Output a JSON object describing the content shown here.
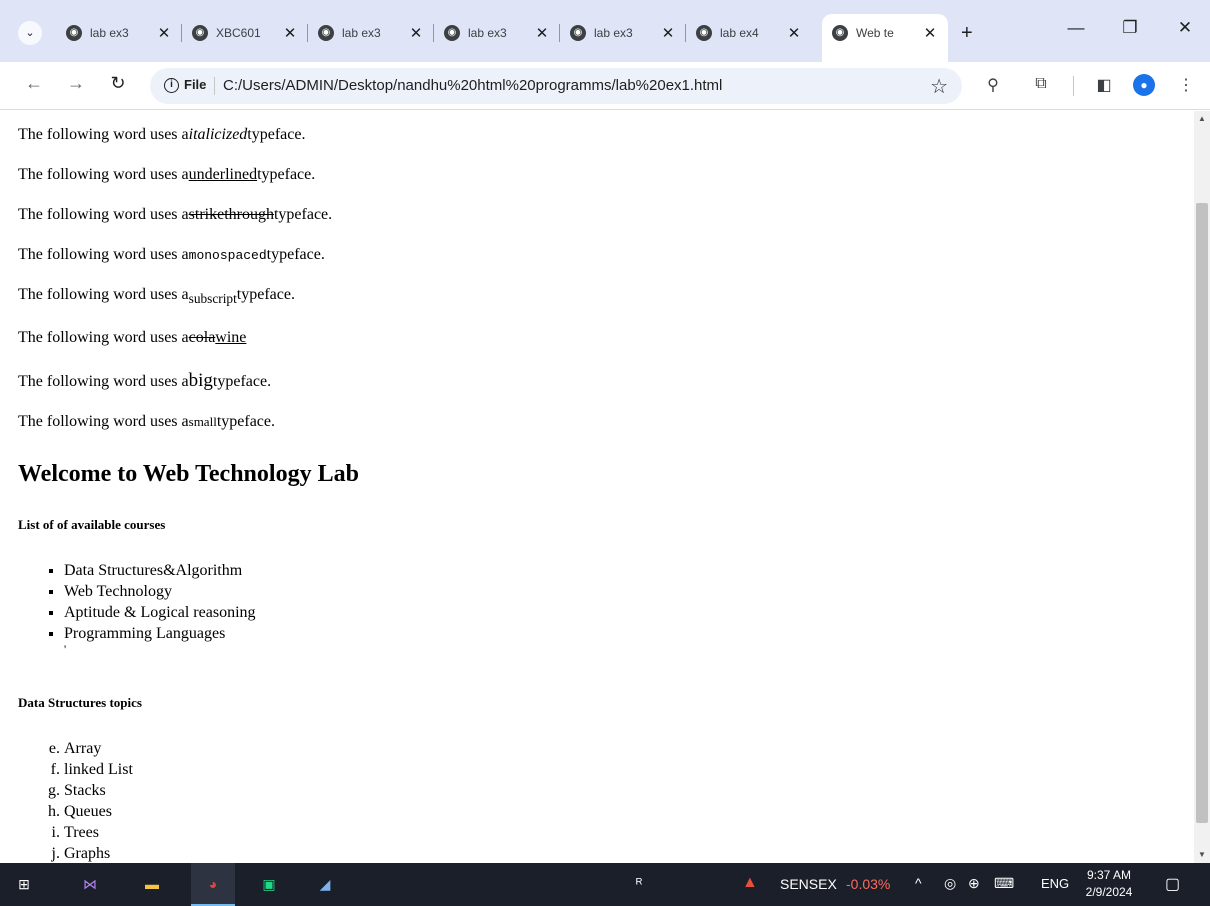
{
  "browser": {
    "tabs": [
      {
        "label": "lab ex3",
        "close": "✕"
      },
      {
        "label": "XBC601",
        "close": "✕"
      },
      {
        "label": "lab ex3",
        "close": "✕"
      },
      {
        "label": "lab ex3",
        "close": "✕"
      },
      {
        "label": "lab ex3",
        "close": "✕"
      },
      {
        "label": "lab ex4",
        "close": "✕"
      },
      {
        "label": "Web te",
        "close": "✕",
        "active": true
      }
    ],
    "new_tab": "+",
    "address_chip": "File",
    "url": "C:/Users/ADMIN/Desktop/nandhu%20html%20programms/lab%20ex1.html"
  },
  "page": {
    "prefix": "The following word uses a",
    "suffix": "typeface.",
    "lines": [
      {
        "word": "italicized"
      },
      {
        "word": "underlined"
      },
      {
        "word": "strikethrough"
      },
      {
        "word": "monospaced"
      },
      {
        "word": "subscript"
      },
      {
        "word_strike": "cola",
        "word_underline": "wine"
      },
      {
        "word": "big"
      },
      {
        "word": "small"
      }
    ],
    "heading": "Welcome to Web Technology Lab",
    "courses_title": "List of of available courses",
    "courses": [
      "Data Structures&Algorithm",
      "Web Technology",
      "Aptitude & Logical reasoning",
      "Programming Languages"
    ],
    "stray_char": "'",
    "topics_title": "Data Structures topics",
    "topics_start": 5,
    "topics": [
      "Array",
      "linked List",
      "Stacks",
      "Queues",
      "Trees",
      "Graphs"
    ]
  },
  "taskbar": {
    "ticker_name": "SENSEX",
    "ticker_change": "-0.03%",
    "language": "ENG",
    "time": "9:37 AM",
    "date": "2/9/2024"
  },
  "colors": {
    "tabstrip": "#dfe5f6",
    "omnibox": "#edf2fa",
    "taskbar": "#1b1f2a",
    "ticker_negative": "#ff6b5b"
  }
}
